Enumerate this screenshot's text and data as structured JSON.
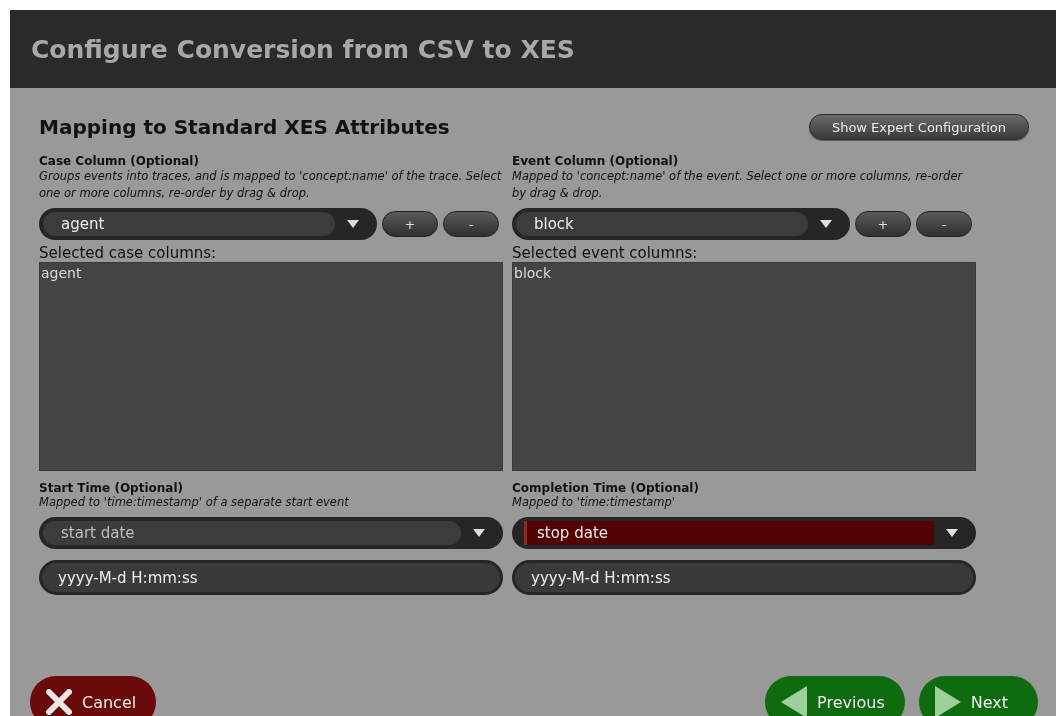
{
  "window": {
    "title": "Configure Conversion from CSV to XES"
  },
  "section": {
    "title": "Mapping to Standard XES Attributes",
    "expert_button": "Show Expert Configuration"
  },
  "columns": [
    {
      "label": "Case Column (Optional)",
      "description": "Groups events into traces, and is mapped to 'concept:name' of the trace. Select one or more columns, re-order by drag & drop.",
      "combo": "agent",
      "add": "+",
      "remove": "-",
      "list_label": "Selected case columns:",
      "items": [
        "agent"
      ]
    },
    {
      "label": "Event Column (Optional)",
      "description": "Mapped to 'concept:name' of the event. Select one or more columns, re-order by drag & drop.",
      "combo": "block",
      "add": "+",
      "remove": "-",
      "list_label": "Selected event columns:",
      "items": [
        "block"
      ]
    }
  ],
  "times": [
    {
      "label": "Start Time (Optional)",
      "description": "Mapped to 'time:timestamp' of a separate start event",
      "combo": "start date",
      "disabled": true,
      "error": false,
      "format": "yyyy-M-d H:mm:ss"
    },
    {
      "label": "Completion Time (Optional)",
      "description": "Mapped to 'time:timestamp'",
      "combo": "stop date",
      "disabled": false,
      "error": true,
      "format": "yyyy-M-d H:mm:ss"
    }
  ],
  "footer": {
    "cancel": "Cancel",
    "previous": "Previous",
    "next": "Next"
  }
}
